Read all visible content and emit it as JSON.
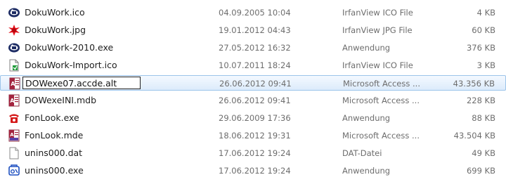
{
  "files": [
    {
      "icon": "irfanview-ico-icon",
      "name": "DokuWork.ico",
      "date": "04.09.2005 10:04",
      "type": "IrfanView ICO File",
      "size": "4 KB"
    },
    {
      "icon": "irfanview-jpg-icon",
      "name": "DokuWork.jpg",
      "date": "19.01.2012 04:43",
      "type": "IrfanView JPG File",
      "size": "60 KB"
    },
    {
      "icon": "application-exe-icon",
      "name": "DokuWork-2010.exe",
      "date": "27.05.2012 16:32",
      "type": "Anwendung",
      "size": "376 KB"
    },
    {
      "icon": "irfanview-ico-icon",
      "name": "DokuWork-Import.ico",
      "date": "10.07.2011 18:24",
      "type": "IrfanView ICO File",
      "size": "3 KB"
    },
    {
      "icon": "access-file-icon",
      "name": "DOWexe07.accde.alt",
      "date": "26.06.2012 09:41",
      "type": "Microsoft Access ...",
      "size": "43.356 KB"
    },
    {
      "icon": "access-mdb-icon",
      "name": "DOWexeINI.mdb",
      "date": "26.06.2012 09:41",
      "type": "Microsoft Access ...",
      "size": "228 KB"
    },
    {
      "icon": "fonlook-exe-icon",
      "name": "FonLook.exe",
      "date": "29.06.2009 17:36",
      "type": "Anwendung",
      "size": "88 KB"
    },
    {
      "icon": "access-mde-icon",
      "name": "FonLook.mde",
      "date": "18.06.2012 19:31",
      "type": "Microsoft Access ...",
      "size": "43.504 KB"
    },
    {
      "icon": "blank-file-icon",
      "name": "unins000.dat",
      "date": "17.06.2012 19:24",
      "type": "DAT-Datei",
      "size": "49 KB"
    },
    {
      "icon": "uninstaller-exe-icon",
      "name": "unins000.exe",
      "date": "17.06.2012 19:24",
      "type": "Anwendung",
      "size": "699 KB"
    }
  ],
  "rename": {
    "row_index": 4,
    "value": "DOWexe07.accde.alt"
  },
  "colors": {
    "selection_border": "#9cc4ea",
    "selection_fill": "#dcebfb",
    "secondary_text": "#6d6d6d"
  }
}
